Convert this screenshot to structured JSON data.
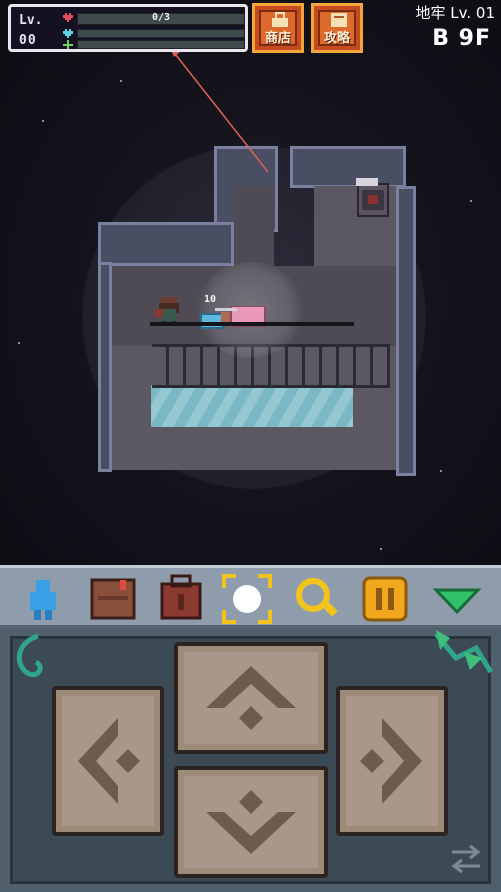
{
  "hud": {
    "level_label": "Lv.",
    "level_value": "00",
    "hp_text": "0/3"
  },
  "buttons": {
    "shop": "商店",
    "guide": "攻略"
  },
  "floor": {
    "title": "地牢 Lv. 01",
    "level": "B 9F"
  },
  "enemy": {
    "hp_value": "10"
  },
  "toolbar": {
    "items": [
      "character-icon",
      "notebook-icon",
      "backpack-icon",
      "focus-icon",
      "magnifier-icon",
      "pause-icon",
      "collapse-icon"
    ]
  },
  "colors": {
    "accent_orange": "#dd6a2c",
    "hud_border": "#e9e6ef",
    "toolbar_bg": "#8f9cab",
    "dpad_button": "#a8978a"
  }
}
